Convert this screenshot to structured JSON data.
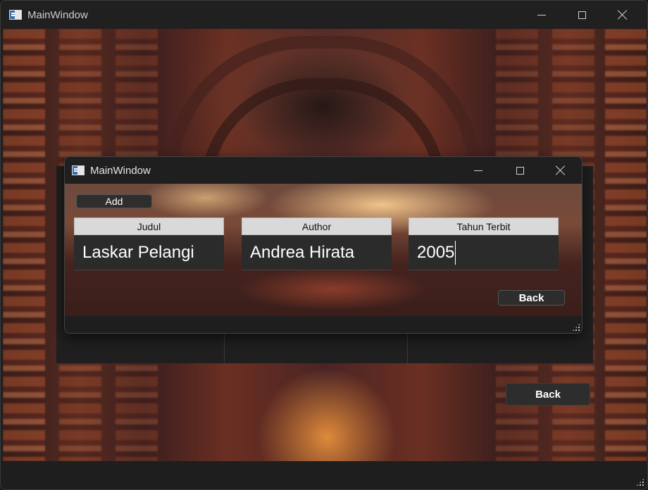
{
  "main_window": {
    "title": "MainWindow",
    "back_label": "Back"
  },
  "dialog": {
    "title": "MainWindow",
    "add_label": "Add",
    "back_label": "Back",
    "fields": [
      {
        "label": "Judul",
        "value": "Laskar Pelangi"
      },
      {
        "label": "Author",
        "value": "Andrea Hirata"
      },
      {
        "label": "Tahun Terbit",
        "value": "2005"
      }
    ]
  }
}
